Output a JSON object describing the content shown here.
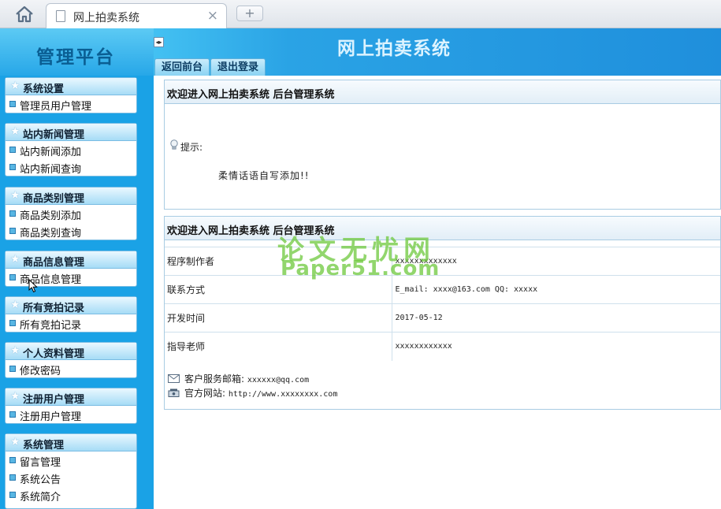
{
  "browser": {
    "tab_title": "网上拍卖系统",
    "close_glyph": "×",
    "new_tab_glyph": "+"
  },
  "header": {
    "platform_title": "管理平台",
    "system_title": "网上拍卖系统",
    "toggle_glyph": "◂▸",
    "buttons": [
      "返回前台",
      "退出登录"
    ]
  },
  "sidebar": {
    "groups": [
      {
        "title": "系统设置",
        "items": [
          "管理员用户管理"
        ]
      },
      {
        "title": "站内新闻管理",
        "items": [
          "站内新闻添加",
          "站内新闻查询"
        ]
      },
      {
        "title": "商品类别管理",
        "items": [
          "商品类别添加",
          "商品类别查询"
        ]
      },
      {
        "title": "商品信息管理",
        "items": [
          "商品信息管理"
        ]
      },
      {
        "title": "所有竞拍记录",
        "items": [
          "所有竞拍记录"
        ]
      },
      {
        "title": "个人资料管理",
        "items": [
          "修改密码"
        ]
      },
      {
        "title": "注册用户管理",
        "items": [
          "注册用户管理"
        ]
      },
      {
        "title": "系统管理",
        "items": [
          "留言管理",
          "系统公告",
          "系统简介"
        ]
      }
    ]
  },
  "welcome_panel": {
    "heading": "欢迎进入网上拍卖系统 后台管理系统",
    "tip_label": "提示:",
    "tip_text": "柔情话语自写添加!!"
  },
  "info_panel": {
    "heading": "欢迎进入网上拍卖系统 后台管理系统",
    "rows": [
      {
        "key": "程序制作者",
        "value": "xxxxxxxxxxxxx"
      },
      {
        "key": "联系方式",
        "value": "E_mail: xxxx@163.com QQ: xxxxx"
      },
      {
        "key": "开发时间",
        "value": "2017-05-12"
      },
      {
        "key": "指导老师",
        "value": "xxxxxxxxxxxx"
      }
    ],
    "email_label": "客户服务邮箱:",
    "email_value": "xxxxxx@qq.com",
    "site_label": "官方网站:",
    "site_value": "http://www.xxxxxxxx.com"
  },
  "watermark": {
    "line1": "论文无忧网",
    "line2": "Paper51.com"
  },
  "icons": {
    "home": "home-icon",
    "document": "document-icon",
    "star": "star-icon",
    "bullet": "square-bullet-icon",
    "bulb": "lightbulb-icon",
    "mail": "mail-icon",
    "phone": "phone-icon"
  },
  "colors": {
    "header_blue": "#1f8fdc",
    "sidebar_blue": "#1aa2e6",
    "watermark_green": "#6ec83c"
  }
}
